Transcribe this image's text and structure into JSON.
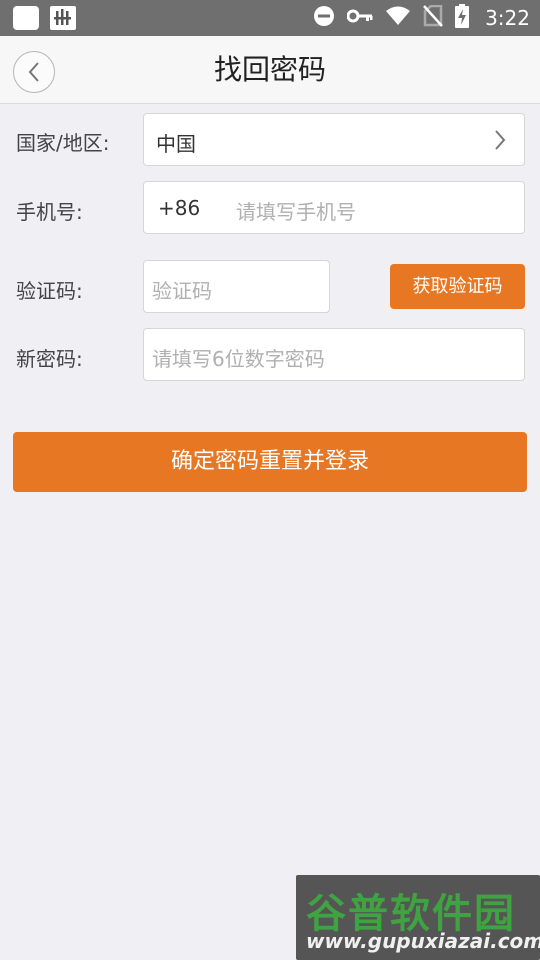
{
  "status_bar": {
    "time": "3:22",
    "icons": [
      "square-notification-icon",
      "app-notification-icon",
      "do-not-disturb-icon",
      "vpn-key-icon",
      "wifi-icon",
      "no-sim-icon",
      "battery-charging-icon"
    ]
  },
  "header": {
    "title": "找回密码"
  },
  "form": {
    "country": {
      "label": "国家/地区:",
      "value": "中国"
    },
    "phone": {
      "label": "手机号:",
      "prefix": "+86",
      "placeholder": "请填写手机号"
    },
    "code": {
      "label": "验证码:",
      "placeholder": "验证码",
      "button_label": "获取验证码"
    },
    "new_password": {
      "label": "新密码:",
      "placeholder": "请填写6位数字密码"
    },
    "submit_label": "确定密码重置并登录"
  },
  "watermark": {
    "logo_text": "谷普软件园",
    "url": "www.gupuxiazai.com"
  },
  "colors": {
    "accent": "#e87723",
    "background": "#efeff4",
    "status_bar": "#6f6f6f"
  }
}
